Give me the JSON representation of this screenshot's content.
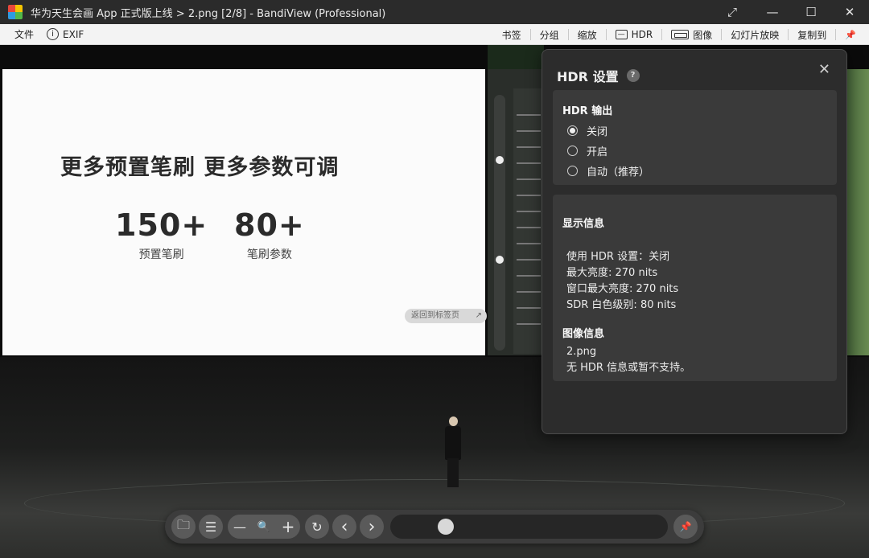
{
  "window": {
    "title": "华为天生会画 App 正式版上线 > 2.png [2/8] - BandiView (Professional)",
    "controls": {
      "expand": "⤢",
      "minimize": "—",
      "maximize": "☐",
      "close": "✕"
    }
  },
  "menubar": {
    "left": [
      {
        "label": "文件",
        "icon": ""
      },
      {
        "label": "EXIF",
        "icon": "info-icon"
      }
    ],
    "right": [
      {
        "label": "书签"
      },
      {
        "label": "分组"
      },
      {
        "label": "缩放"
      },
      {
        "label": "HDR"
      },
      {
        "label": "图像"
      },
      {
        "label": "幻灯片放映"
      },
      {
        "label": "复制到"
      }
    ],
    "pin_icon": "📌"
  },
  "slide": {
    "headline": "更多预置笔刷 更多参数可调",
    "stats": [
      {
        "value": "150+",
        "label": "预置笔刷"
      },
      {
        "value": "80+",
        "label": "笔刷参数"
      }
    ],
    "return_link": "返回到标签页",
    "return_icon": "↗"
  },
  "hdr_panel": {
    "title": "HDR 设置",
    "help": "?",
    "close": "✕",
    "output": {
      "title": "HDR 输出",
      "options": [
        {
          "label": "关闭",
          "checked": true
        },
        {
          "label": "开启",
          "checked": false
        },
        {
          "label": "自动（推荐）",
          "checked": false
        }
      ]
    },
    "display_info": {
      "title": "显示信息",
      "lines": [
        "使用 HDR 设置：关闭",
        "最大亮度: 270 nits",
        "窗口最大亮度: 270 nits",
        "SDR 白色级别: 80 nits"
      ]
    },
    "image_info": {
      "title": "图像信息",
      "lines": [
        "2.png",
        "无 HDR 信息或暂不支持。"
      ]
    }
  },
  "toolbar": {
    "open": "🗀",
    "list": "☰",
    "zoom_out": "—",
    "zoom_fit": "🔍",
    "zoom_in": "+",
    "rotate": "↻",
    "prev": "‹",
    "next": "›",
    "pin": "📌",
    "seek_position": 0.17
  },
  "colors": {
    "titlebar": "#2b2b2b",
    "menubar": "#f3f3f3",
    "panel": "#2c2c2c",
    "section": "#3a3a3a"
  }
}
